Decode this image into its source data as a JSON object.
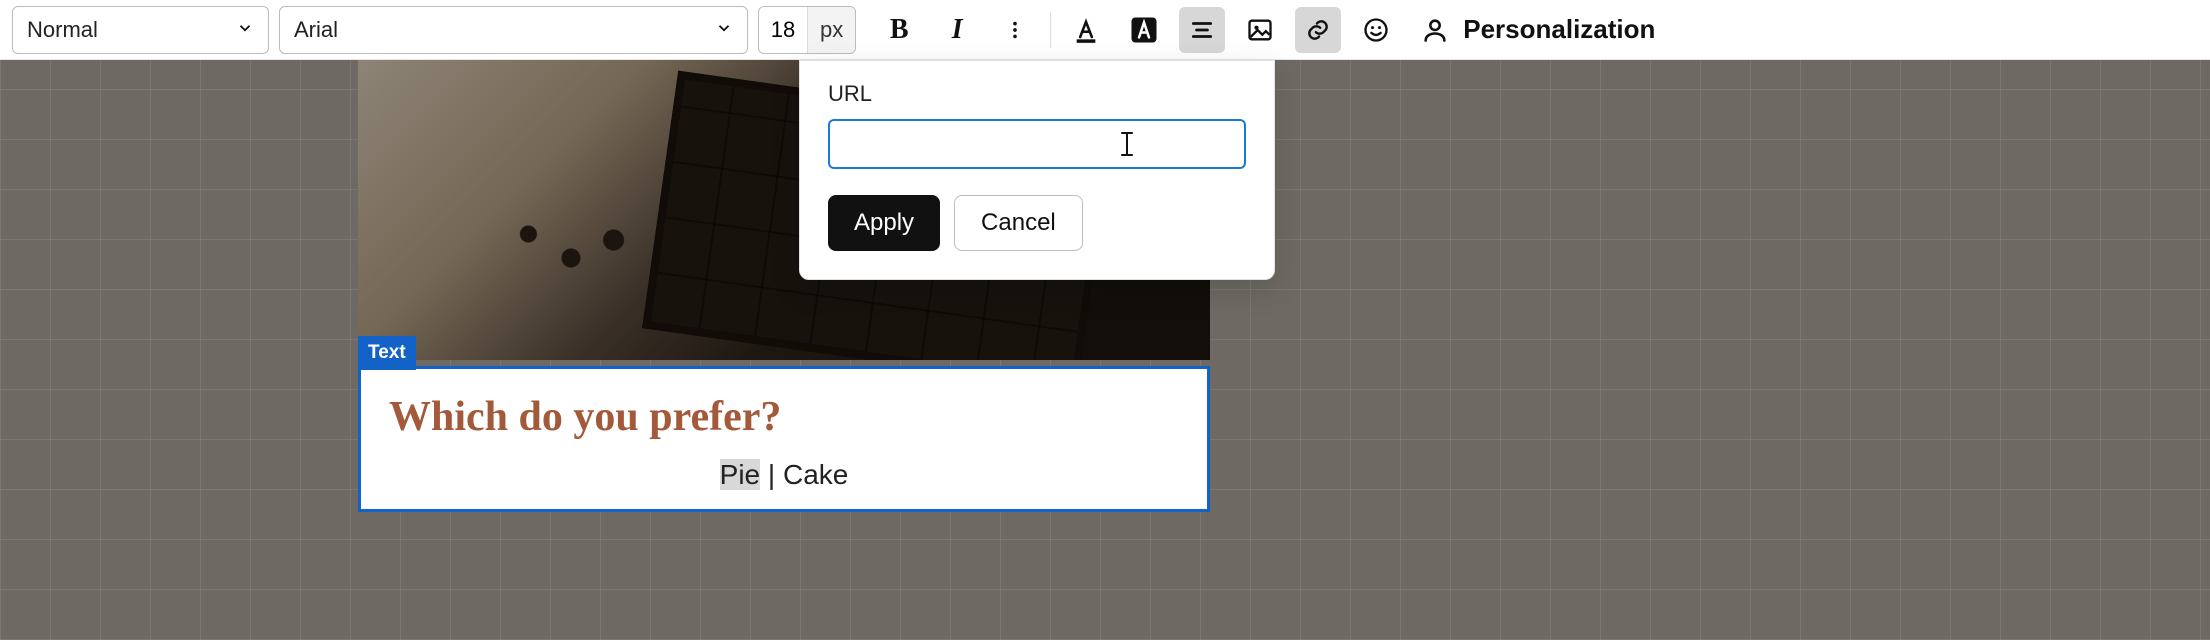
{
  "toolbar": {
    "style_select": "Normal",
    "font_select": "Arial",
    "font_size": "18",
    "font_size_unit": "px",
    "personalization_label": "Personalization"
  },
  "link_popover": {
    "url_label": "URL",
    "url_value": "",
    "url_placeholder": "",
    "apply_label": "Apply",
    "cancel_label": "Cancel"
  },
  "block": {
    "tag_label": "Text",
    "heading": "Which do you prefer?",
    "body_selected": "Pie",
    "body_separator": " | ",
    "body_rest": "Cake"
  }
}
